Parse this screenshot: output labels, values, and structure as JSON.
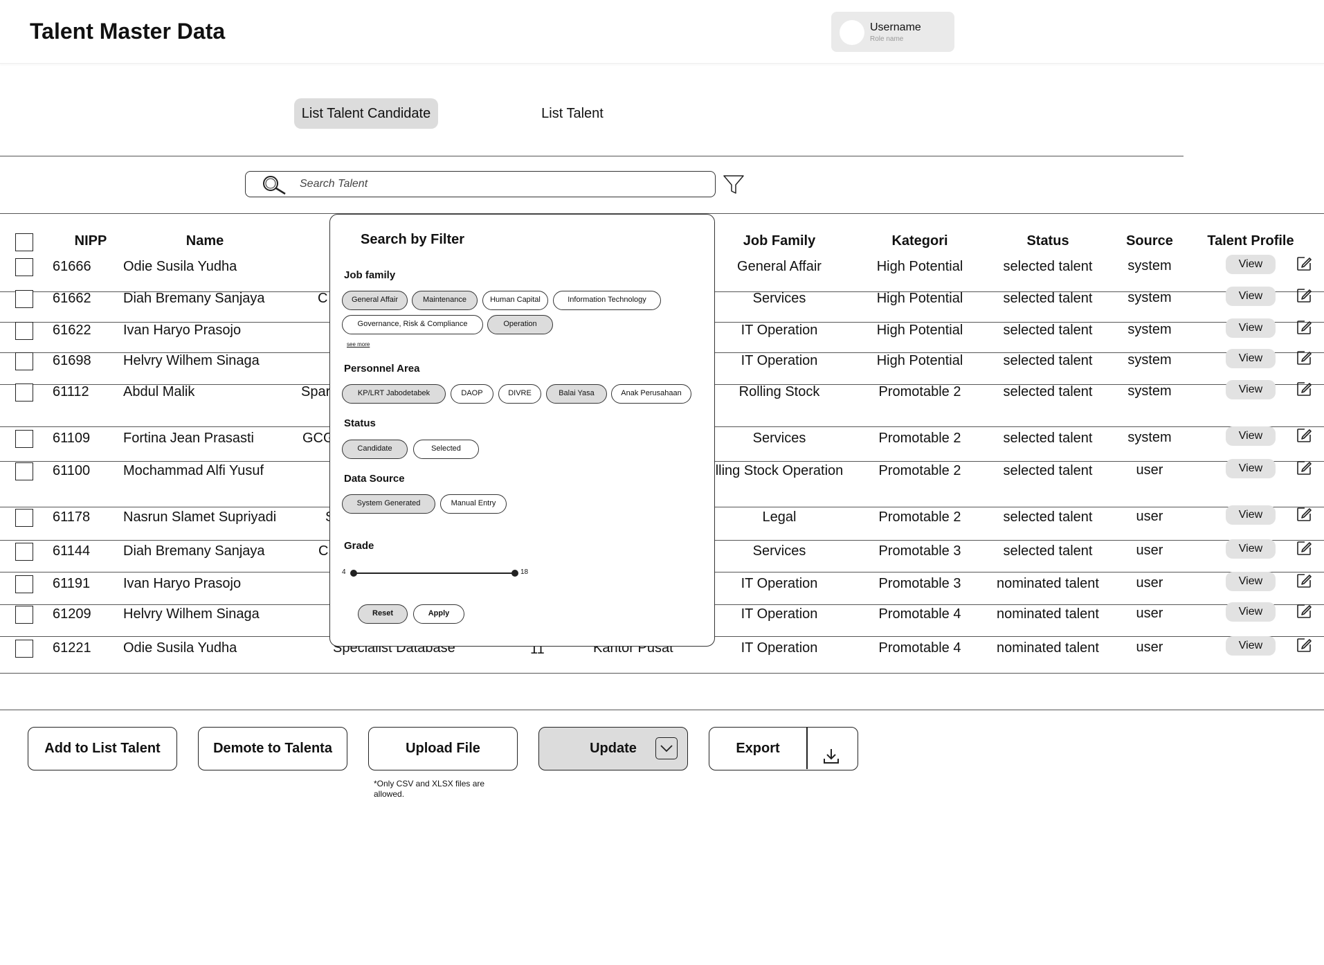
{
  "header": {
    "title": "Talent Master Data",
    "user": {
      "name": "Username",
      "role": "Role name"
    }
  },
  "tabs": [
    {
      "label": "List Talent Candidate",
      "active": true
    },
    {
      "label": "List Talent",
      "active": false
    }
  ],
  "search": {
    "placeholder": "Search Talent",
    "value": ""
  },
  "table": {
    "headers": {
      "nipp": "NIPP",
      "name": "Name",
      "job_family": "Job Family",
      "kategori": "Kategori",
      "status": "Status",
      "source": "Source",
      "talent_profile": "Talent Profile"
    },
    "view_label": "View",
    "rows": [
      {
        "nipp": "61666",
        "name": "Odie Susila Yudha",
        "partial": "",
        "job_family": "General Affair",
        "kategori": "High Potential",
        "status": "selected talent",
        "source": "system"
      },
      {
        "nipp": "61662",
        "name": "Diah Bremany Sanjaya",
        "partial": "C",
        "job_family": "Services",
        "kategori": "High Potential",
        "status": "selected talent",
        "source": "system"
      },
      {
        "nipp": "61622",
        "name": "Ivan Haryo Prasojo",
        "partial": "",
        "job_family": "IT Operation",
        "kategori": "High Potential",
        "status": "selected talent",
        "source": "system"
      },
      {
        "nipp": "61698",
        "name": "Helvry Wilhem Sinaga",
        "partial": "",
        "job_family": "IT Operation",
        "kategori": "High Potential",
        "status": "selected talent",
        "source": "system"
      },
      {
        "nipp": "61112",
        "name": "Abdul Malik",
        "partial": "Spar",
        "job_family": "Rolling Stock",
        "kategori": "Promotable 2",
        "status": "selected talent",
        "source": "system"
      },
      {
        "nipp": "61109",
        "name": "Fortina Jean Prasasti",
        "partial": "GCG",
        "job_family": "Services",
        "kategori": "Promotable 2",
        "status": "selected talent",
        "source": "system"
      },
      {
        "nipp": "61100",
        "name": "Mochammad Alfi Yusuf",
        "partial": "",
        "job_family": "lling Stock Operation",
        "kategori": "Promotable 2",
        "status": "selected talent",
        "source": "user"
      },
      {
        "nipp": "61178",
        "name": "Nasrun Slamet Supriyadi",
        "partial": "S",
        "job_family": "Legal",
        "kategori": "Promotable 2",
        "status": "selected talent",
        "source": "user"
      },
      {
        "nipp": "61144",
        "name": "Diah Bremany Sanjaya",
        "partial": "C",
        "job_family": "Services",
        "kategori": "Promotable 3",
        "status": "selected talent",
        "source": "user"
      },
      {
        "nipp": "61191",
        "name": "Ivan Haryo Prasojo",
        "partial": "",
        "job_family": "IT Operation",
        "kategori": "Promotable 3",
        "status": "nominated talent",
        "source": "user"
      },
      {
        "nipp": "61209",
        "name": "Helvry Wilhem Sinaga",
        "partial": "",
        "job_family": "IT Operation",
        "kategori": "Promotable 4",
        "status": "nominated talent",
        "source": "user"
      },
      {
        "nipp": "61221",
        "name": "Odie Susila Yudha",
        "partial": "Specialist Database",
        "grade": "11",
        "personnel_area": "Kantor Pusat",
        "job_family": "IT Operation",
        "kategori": "Promotable 4",
        "status": "nominated talent",
        "source": "user"
      }
    ]
  },
  "filter_popup": {
    "title": "Search by Filter",
    "job_family": {
      "label": "Job family",
      "chips": [
        {
          "label": "General Affair",
          "selected": true
        },
        {
          "label": "Maintenance",
          "selected": true
        },
        {
          "label": "Human Capital",
          "selected": false
        },
        {
          "label": "Information Technology",
          "selected": false
        },
        {
          "label": "Governance, Risk & Compliance",
          "selected": false
        },
        {
          "label": "Operation",
          "selected": true
        }
      ],
      "see_more": "see more"
    },
    "personnel_area": {
      "label": "Personnel Area",
      "chips": [
        {
          "label": "KP/LRT Jabodetabek",
          "selected": true
        },
        {
          "label": "DAOP",
          "selected": false
        },
        {
          "label": "DIVRE",
          "selected": false
        },
        {
          "label": "Balai Yasa",
          "selected": true
        },
        {
          "label": "Anak Perusahaan",
          "selected": false
        }
      ]
    },
    "status": {
      "label": "Status",
      "chips": [
        {
          "label": "Candidate",
          "selected": true
        },
        {
          "label": "Selected",
          "selected": false
        }
      ]
    },
    "data_source": {
      "label": "Data Source",
      "chips": [
        {
          "label": "System Generated",
          "selected": true
        },
        {
          "label": "Manual Entry",
          "selected": false
        }
      ]
    },
    "grade": {
      "label": "Grade",
      "min": "4",
      "max": "18"
    },
    "reset_label": "Reset",
    "apply_label": "Apply"
  },
  "actions": {
    "add_label": "Add to List Talent",
    "demote_label": "Demote to Talenta",
    "upload_label": "Upload File",
    "upload_note": "*Only CSV and XLSX files are allowed.",
    "update_label": "Update",
    "export_label": "Export"
  },
  "icons": {
    "search": "search-icon",
    "filter": "filter-icon",
    "edit": "edit-icon",
    "chevron": "chevron-down-icon",
    "download": "download-icon"
  }
}
